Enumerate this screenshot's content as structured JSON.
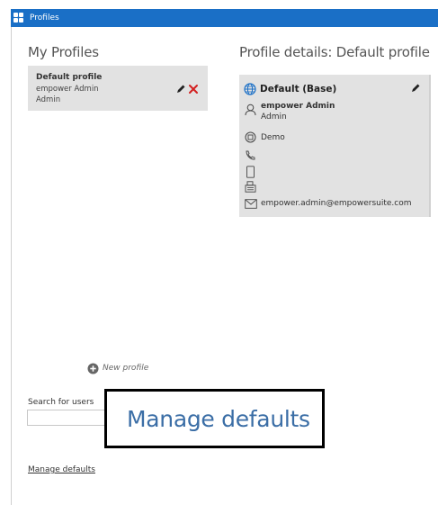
{
  "window": {
    "title": "Profiles"
  },
  "my_profiles": {
    "heading": "My Profiles",
    "items": [
      {
        "name": "Default profile",
        "user": "empower Admin",
        "role": "Admin"
      }
    ]
  },
  "details": {
    "heading": "Profile details: Default profile",
    "profile_title": "Default (Base)",
    "user": "empower Admin",
    "role": "Admin",
    "organization": "Demo",
    "phone": "",
    "mobile": "",
    "fax": "",
    "email": "empower.admin@empowersuite.com"
  },
  "new_profile_label": "New profile",
  "search": {
    "label": "Search for users",
    "value": ""
  },
  "callout_text": "Manage defaults",
  "manage_defaults_link": "Manage defaults",
  "colors": {
    "titlebar": "#1a6fc6",
    "card_bg": "#e2e2e2",
    "delete_red": "#d32020",
    "link_blue": "#3b6ea6"
  }
}
